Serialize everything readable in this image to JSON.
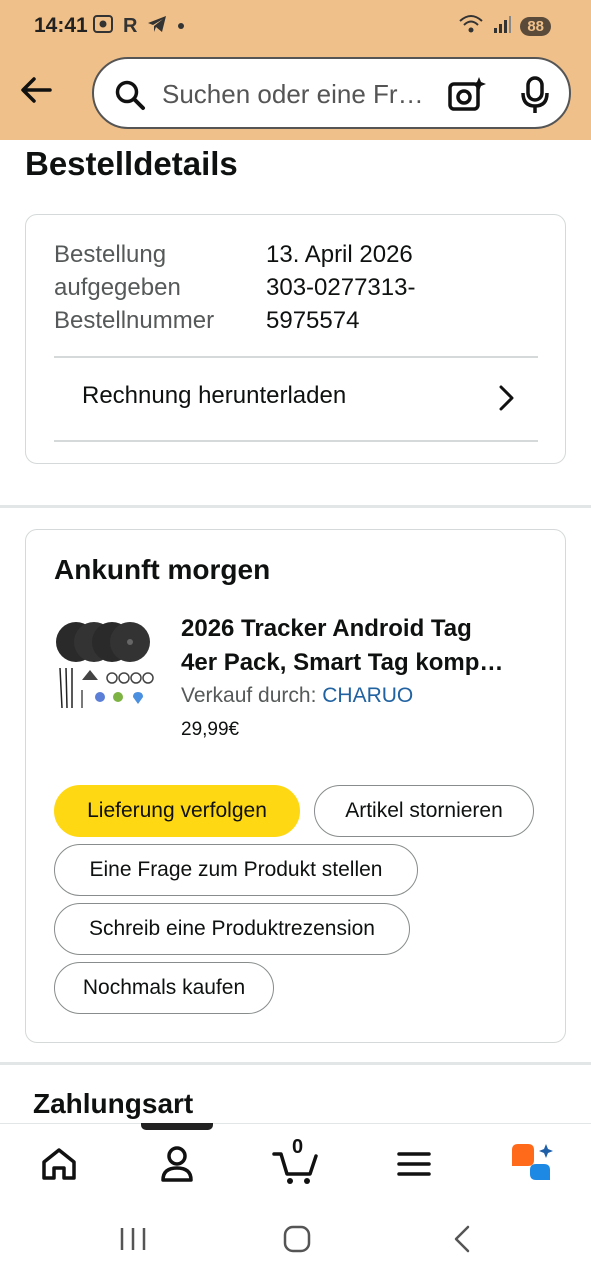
{
  "status_bar": {
    "time": "14:41",
    "battery": "88",
    "icons": [
      "screen-record-icon",
      "r-app-icon",
      "telegram-icon",
      "dot-icon",
      "wifi-icon",
      "signal-icon"
    ]
  },
  "header": {
    "search_placeholder": "Suchen oder eine Fr…",
    "icons": [
      "back-arrow-icon",
      "search-icon",
      "camera-icon",
      "microphone-icon"
    ]
  },
  "page_title": "Bestelldetails",
  "order_summary": {
    "rows": [
      {
        "label": "Bestellung",
        "value": "13. April 2026"
      },
      {
        "label": "aufgegeben",
        "value": "303-0277313-"
      },
      {
        "label": "Bestellnummer",
        "value": "5975574"
      }
    ],
    "invoice_link": "Rechnung herunterladen"
  },
  "shipment": {
    "arrival": "Ankunft morgen",
    "product_title_line1": "2026 Tracker Android Tag",
    "product_title_line2": "4er Pack, Smart Tag komp…",
    "seller_label": "Verkauf durch:",
    "seller_name": "CHARUO",
    "price": "29,99€",
    "buttons": {
      "track": "Lieferung verfolgen",
      "cancel": "Artikel stornieren",
      "question": "Eine Frage zum Produkt stellen",
      "review": "Schreib eine Produktrezension",
      "buy_again": "Nochmals kaufen"
    }
  },
  "payment_title": "Zahlungsart",
  "bottom_nav": {
    "items": [
      "home-icon",
      "account-icon",
      "cart-icon",
      "menu-icon",
      "rufus-icon"
    ],
    "cart_count": "0",
    "active": "account-icon"
  },
  "colors": {
    "header_bg": "#f0c08a",
    "primary_button": "#ffd814",
    "link": "#2162a1"
  }
}
